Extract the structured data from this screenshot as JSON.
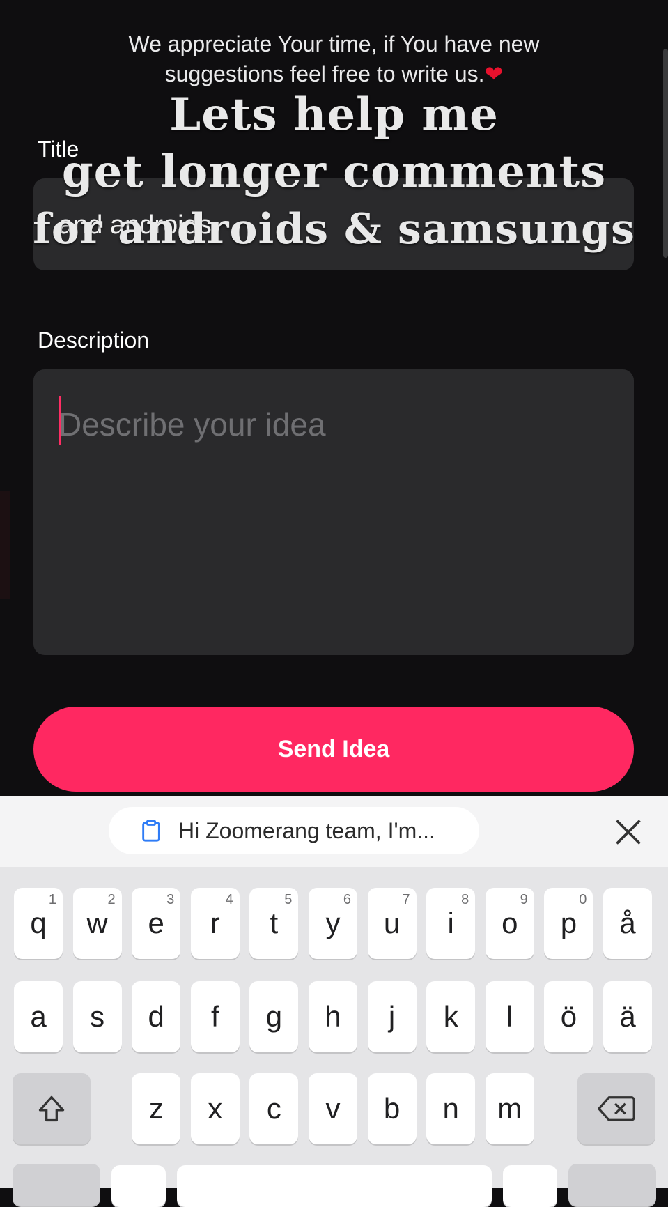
{
  "header": {
    "message_line1": "We appreciate Your time, if You have new",
    "message_line2": "suggestions feel free to write us.",
    "heart": "❤"
  },
  "overlay": {
    "line1": "Lets help me",
    "line2": "get longer comments",
    "line3": "for androids & samsungs"
  },
  "form": {
    "title_label": "Title",
    "title_value": "and androids.",
    "description_label": "Description",
    "description_placeholder": "Describe your idea",
    "send_label": "Send Idea"
  },
  "keyboard": {
    "clipboard_suggestion": "Hi Zoomerang team, I'm...",
    "row1": [
      {
        "k": "q",
        "n": "1"
      },
      {
        "k": "w",
        "n": "2"
      },
      {
        "k": "e",
        "n": "3"
      },
      {
        "k": "r",
        "n": "4"
      },
      {
        "k": "t",
        "n": "5"
      },
      {
        "k": "y",
        "n": "6"
      },
      {
        "k": "u",
        "n": "7"
      },
      {
        "k": "i",
        "n": "8"
      },
      {
        "k": "o",
        "n": "9"
      },
      {
        "k": "p",
        "n": "0"
      },
      {
        "k": "å",
        "n": ""
      }
    ],
    "row2": [
      "a",
      "s",
      "d",
      "f",
      "g",
      "h",
      "j",
      "k",
      "l",
      "ö",
      "ä"
    ],
    "row3": [
      "z",
      "x",
      "c",
      "v",
      "b",
      "n",
      "m"
    ]
  },
  "colors": {
    "accent": "#ff2861",
    "background": "#0f0e10",
    "input_bg": "#2a2a2c"
  }
}
